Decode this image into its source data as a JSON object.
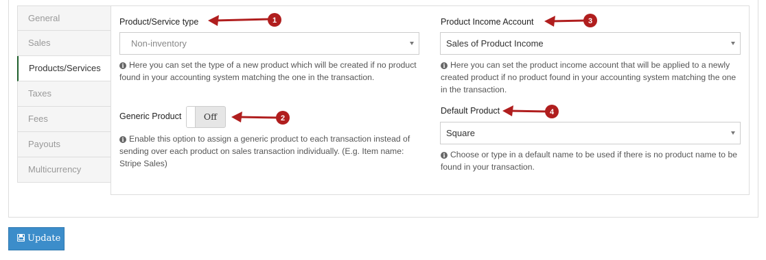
{
  "sidebar": {
    "items": [
      {
        "label": "General"
      },
      {
        "label": "Sales"
      },
      {
        "label": "Products/Services"
      },
      {
        "label": "Taxes"
      },
      {
        "label": "Fees"
      },
      {
        "label": "Payouts"
      },
      {
        "label": "Multicurrency"
      }
    ],
    "active_index": 2
  },
  "product_type": {
    "label": "Product/Service type",
    "selected": "Non-inventory",
    "help": "Here you can set the type of a new product which will be created if no product found in your accounting system matching the one in the transaction.",
    "marker": "1"
  },
  "generic_product": {
    "label": "Generic Product",
    "toggle_text": "Off",
    "help": "Enable this option to assign a generic product to each transaction instead of sending over each product on sales transaction individually. (E.g. Item name: Stripe Sales)",
    "marker": "2"
  },
  "income_account": {
    "label": "Product Income Account",
    "selected": "Sales of Product Income",
    "help": "Here you can set the product income account that will be applied to a newly created product if no product found in your accounting system matching the one in the transaction.",
    "marker": "3"
  },
  "default_product": {
    "label": "Default Product",
    "selected": "Square",
    "help": "Choose or type in a default name to be used if there is no product name to be found in your transaction.",
    "marker": "4"
  },
  "update_button": {
    "label": "Update"
  },
  "colors": {
    "arrow": "#b01e1e",
    "button": "#3c8dca",
    "active_tab_accent": "#1d5e2a"
  },
  "icons": {
    "info": "info-circle-icon",
    "save": "floppy-disk-icon",
    "dropdown": "caret-down-icon"
  }
}
